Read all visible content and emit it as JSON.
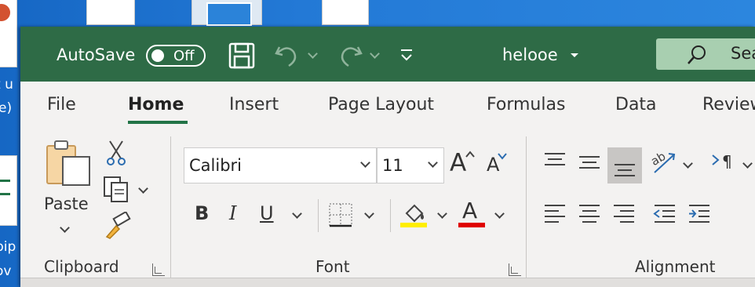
{
  "desktop": {
    "labels": [
      "t u",
      "e)",
      "pip",
      "ov"
    ]
  },
  "titlebar": {
    "autosave_label": "AutoSave",
    "autosave_state": "Off",
    "file_name": "helooe",
    "search_placeholder": "Sea"
  },
  "tabs": [
    {
      "label": "File"
    },
    {
      "label": "Home"
    },
    {
      "label": "Insert"
    },
    {
      "label": "Page Layout"
    },
    {
      "label": "Formulas"
    },
    {
      "label": "Data"
    },
    {
      "label": "Review"
    }
  ],
  "ribbon": {
    "clipboard": {
      "paste_label": "Paste",
      "group_label": "Clipboard"
    },
    "font": {
      "font_name": "Calibri",
      "font_size": "11",
      "group_label": "Font",
      "bold": "B",
      "italic": "I",
      "underline": "U",
      "grow": "A",
      "shrink": "A",
      "font_color_glyph": "A",
      "highlight_color": "#ffee00",
      "font_color": "#e00000"
    },
    "alignment": {
      "group_label": "Alignment",
      "rtl_glyph": "¶"
    }
  },
  "colors": {
    "titlebar": "#2e6b46",
    "accent": "#217346",
    "search_bg": "#a8cfb0"
  }
}
